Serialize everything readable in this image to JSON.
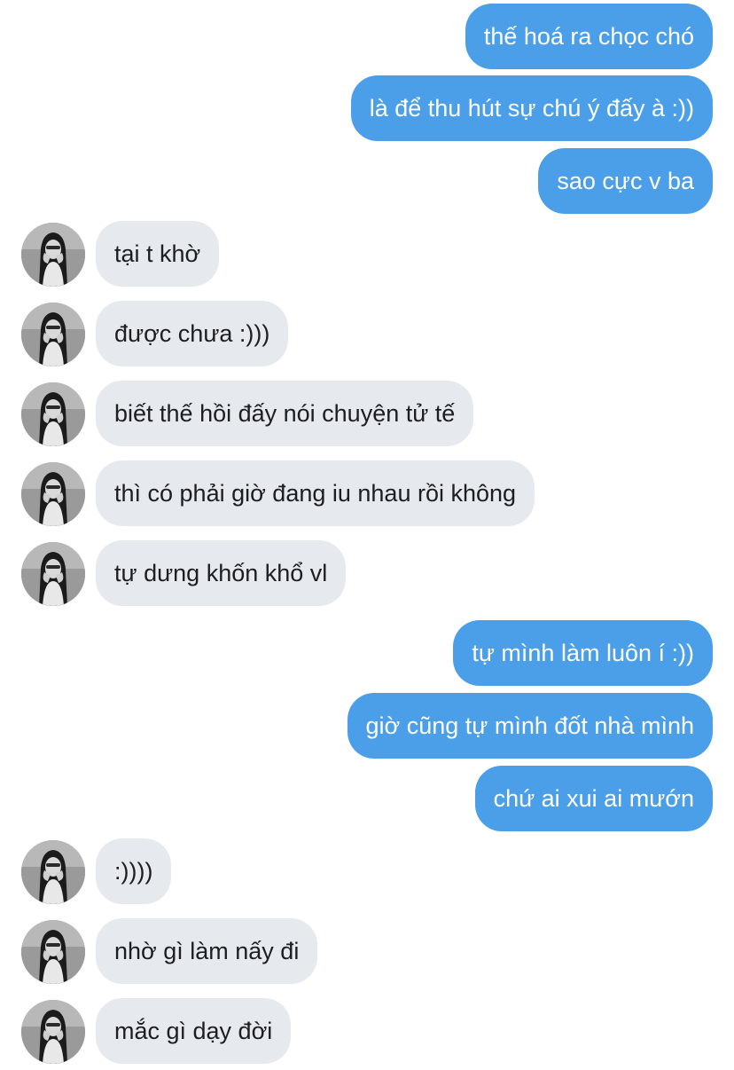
{
  "thread": {
    "messages": [
      {
        "from": "me",
        "text": "thế hoá ra chọc chó"
      },
      {
        "from": "me",
        "text": "là để thu hút sự chú ý đấy à :))"
      },
      {
        "from": "me",
        "text": "sao cực v ba"
      },
      {
        "from": "them",
        "text": "tại t khờ"
      },
      {
        "from": "them",
        "text": "được chưa :)))"
      },
      {
        "from": "them",
        "text": "biết thế hồi đấy nói chuyện tử tế"
      },
      {
        "from": "them",
        "text": "thì có phải giờ đang iu nhau rồi không"
      },
      {
        "from": "them",
        "text": "tự dưng khốn khổ vl"
      },
      {
        "from": "me",
        "text": "tự mình làm luôn í :))"
      },
      {
        "from": "me",
        "text": "giờ cũng tự mình đốt nhà mình"
      },
      {
        "from": "me",
        "text": "chứ ai xui ai mướn"
      },
      {
        "from": "them",
        "text": ":))))"
      },
      {
        "from": "them",
        "text": "nhờ gì làm nấy đi"
      },
      {
        "from": "them",
        "text": "mắc gì dạy đời"
      }
    ]
  },
  "colors": {
    "sent_bubble": "#4a9fe8",
    "sent_text": "#ffffff",
    "received_bubble": "#e6e9ed",
    "received_text": "#1c1e21"
  },
  "icons": {
    "avatar": "profile-photo-avatar"
  }
}
